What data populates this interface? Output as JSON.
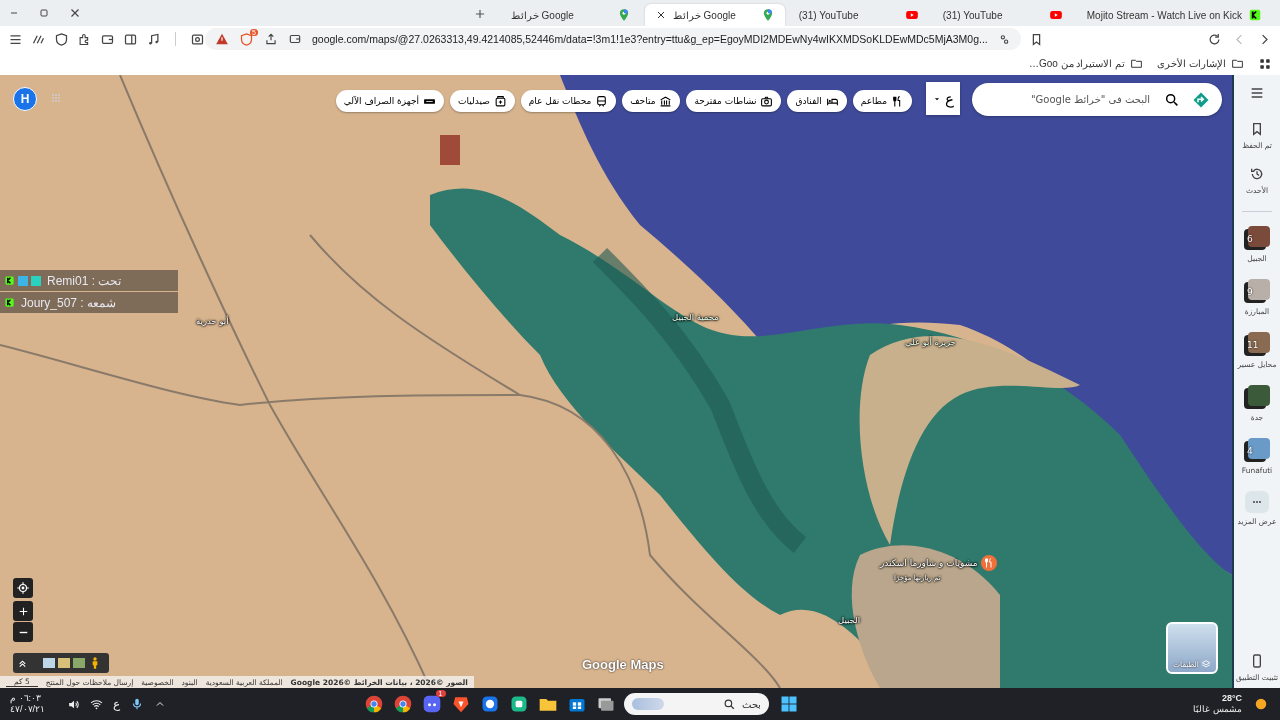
{
  "tabs": [
    {
      "title": "Mojito Stream - Watch Live on Kick",
      "kind": "kick",
      "selected": false
    },
    {
      "title": "(31) YouTube",
      "kind": "youtube",
      "selected": false
    },
    {
      "title": "(31) YouTube",
      "kind": "youtube",
      "selected": false
    },
    {
      "title": "خرائط Google",
      "kind": "maps",
      "selected": true
    },
    {
      "title": "خرائط Google",
      "kind": "maps",
      "selected": false
    }
  ],
  "address_bar": {
    "url": "google.com/maps/@27.0263313,49.4214085,52446m/data=!3m1!1e3?entry=ttu&g_ep=EgoyMDI2MDEwNy4wIKXMDSoKLDEwMDc5MjA3M0g...",
    "shield_count": "5"
  },
  "bookmarks": [
    {
      "label": "الإشارات الأخرى"
    },
    {
      "label": "تم الاستيراد من Goo…"
    }
  ],
  "map": {
    "search": {
      "placeholder": "البحث في \"خرائط Google\""
    },
    "language": "ع",
    "chips": [
      {
        "label": "مطاعم",
        "kind": "restaurant"
      },
      {
        "label": "الفنادق",
        "kind": "hotel"
      },
      {
        "label": "نشاطات مقترحة",
        "kind": "camera"
      },
      {
        "label": "متاحف",
        "kind": "museum"
      },
      {
        "label": "محطات نقل عام",
        "kind": "transit"
      },
      {
        "label": "صيدليات",
        "kind": "pharmacy"
      },
      {
        "label": "أجهزة الصراف الآلي",
        "kind": "atm"
      }
    ],
    "avatar": "H",
    "chat": [
      {
        "text": "Remi01 : تحت",
        "badges": [
          {
            "kind": "kick"
          },
          {
            "kind": "emote"
          },
          {
            "kind": "sub"
          }
        ]
      },
      {
        "text": "Joury_507 : شمعه",
        "badges": [
          {
            "kind": "kick"
          }
        ]
      }
    ],
    "labels": [
      {
        "text": "محمية الجبيل",
        "kind": "area"
      },
      {
        "text": "جزيرة أبو علي",
        "kind": "area"
      },
      {
        "text": "مشويات و شاورما اسكندر",
        "kind": "place"
      },
      {
        "text": "تم زيارتها مؤخرًا",
        "kind": "note"
      },
      {
        "text": "أبو حدرية",
        "kind": "town"
      },
      {
        "text": "الجبيل",
        "kind": "town"
      }
    ],
    "logo": "Google Maps",
    "layers": "الطبقات",
    "scale": "5 كم",
    "attribution": [
      "الصور ©2026 ، بيانات الخرائط ©2026 Google",
      "المملكة العربية السعودية",
      "البنود",
      "الخصوصية",
      "إرسال ملاحظات حول المنتج"
    ]
  },
  "sidebar": {
    "nav": [
      {
        "label": "تم الحفظ",
        "kind": "saved"
      },
      {
        "label": "الأحدث",
        "kind": "recent"
      }
    ],
    "recent": [
      {
        "label": "الجبيل",
        "count": "6",
        "color": "#7a4a3a"
      },
      {
        "label": "المبارزة",
        "count": "9",
        "color": "#b8b0a8"
      },
      {
        "label": "محايل عسير",
        "count": "11",
        "color": "#8a6a50"
      },
      {
        "label": "جدة",
        "color": "#3a5a3a"
      },
      {
        "label": "Funafuti",
        "count": "4",
        "color": "#6a9ac8"
      }
    ],
    "more": "عرض المزيد",
    "install": "تثبيت التطبيق"
  },
  "taskbar": {
    "clock": {
      "time": "٠٦:٠٣ م",
      "date": "٤٧/٠٧/٢١"
    },
    "language": "ع",
    "apps": [
      {
        "kind": "chrome"
      },
      {
        "kind": "chrome"
      },
      {
        "kind": "discord",
        "badge": "1"
      },
      {
        "kind": "brave"
      },
      {
        "kind": "app"
      },
      {
        "kind": "app2"
      },
      {
        "kind": "folder"
      },
      {
        "kind": "store"
      },
      {
        "kind": "window"
      }
    ],
    "search": {
      "placeholder": "بحث"
    },
    "weather": {
      "temp": "28°C",
      "condition": "مشمس غالبًا"
    }
  }
}
